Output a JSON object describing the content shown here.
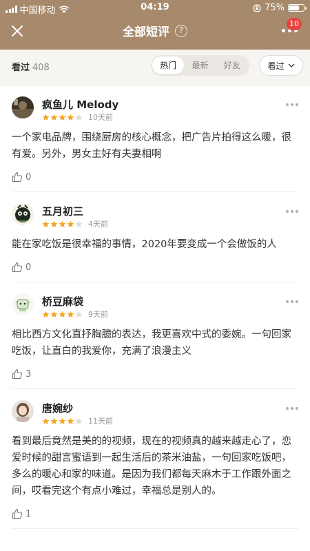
{
  "status_bar": {
    "carrier": "中国移动",
    "time": "04:19",
    "battery_percent": "75%",
    "battery_level": 0.75
  },
  "nav": {
    "title": "全部短评",
    "help": "?",
    "badge": "10"
  },
  "filter": {
    "label": "看过",
    "count": "408",
    "tabs": [
      {
        "label": "热门",
        "active": true
      },
      {
        "label": "最新",
        "active": false
      },
      {
        "label": "好友",
        "active": false
      }
    ],
    "dropdown_label": "看过"
  },
  "colors": {
    "header_bg": "#a78a6c",
    "star_color": "#f5a623",
    "badge_red": "#e64340"
  },
  "comments": [
    {
      "name": "疯鱼儿 Melody",
      "rating": 4,
      "time": "10天前",
      "text": "一个家电品牌，围绕厨房的核心概念，把广告片拍得这么暖，很有爱。另外，男女主好有夫妻相啊",
      "likes": "0"
    },
    {
      "name": "五月初三",
      "rating": 4,
      "time": "4天前",
      "text": "能在家吃饭是很幸福的事情，2020年要变成一个会做饭的人",
      "likes": "0"
    },
    {
      "name": "桥豆麻袋",
      "rating": 4,
      "time": "9天前",
      "text": "相比西方文化直抒胸臆的表达，我更喜欢中式的委婉。一句回家吃饭，让直白的我爱你，充满了浪漫主义",
      "likes": "3"
    },
    {
      "name": "唐婉纱",
      "rating": 4,
      "time": "11天前",
      "text": "看到最后竟然是美的的视频，现在的视频真的越来越走心了，恋爱时候的甜言蜜语到一起生活后的茶米油盐，一句回家吃饭吧，多么的暖心和家的味道。是因为我们都每天麻木于工作跟外面之间，哎看完这个有点小难过，幸福总是别人的。",
      "likes": "1"
    }
  ]
}
